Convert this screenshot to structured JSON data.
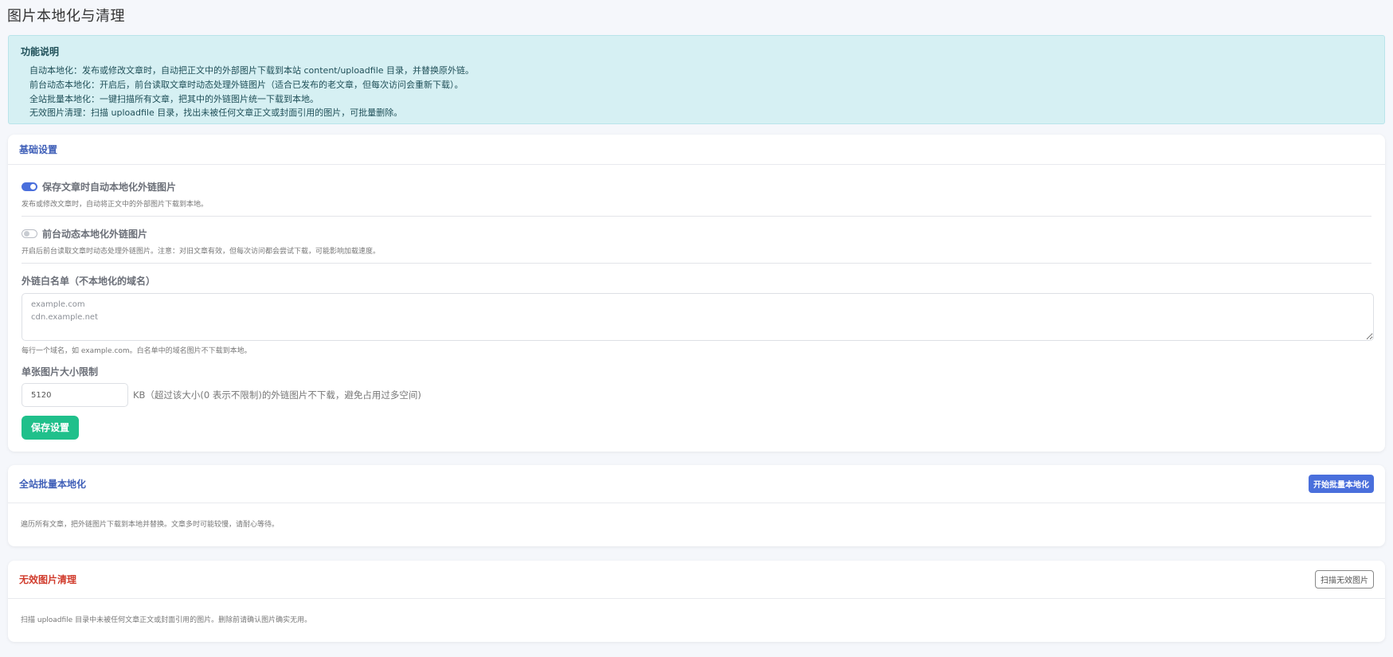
{
  "page": {
    "title": "图片本地化与清理"
  },
  "info": {
    "title": "功能说明",
    "lines": [
      "自动本地化：发布或修改文章时，自动把正文中的外部图片下载到本站 content/uploadfile 目录，并替换原外链。",
      "前台动态本地化：开启后，前台读取文章时动态处理外链图片（适合已发布的老文章，但每次访问会重新下载）。",
      "全站批量本地化：一键扫描所有文章，把其中的外链图片统一下载到本地。",
      "无效图片清理：扫描 uploadfile 目录，找出未被任何文章正文或封面引用的图片，可批量删除。"
    ]
  },
  "settings": {
    "title": "基础设置",
    "auto_localize": {
      "label": "保存文章时自动本地化外链图片",
      "help": "发布或修改文章时，自动将正文中的外部图片下载到本地。",
      "enabled": true
    },
    "dynamic_localize": {
      "label": "前台动态本地化外链图片",
      "help": "开启后前台读取文章时动态处理外链图片。注意：对旧文章有效，但每次访问都会尝试下载，可能影响加载速度。",
      "enabled": false
    },
    "whitelist": {
      "label": "外链白名单（不本地化的域名）",
      "placeholder": "example.com\ncdn.example.net",
      "value": "",
      "help": "每行一个域名，如 example.com。白名单中的域名图片不下载到本地。"
    },
    "size_limit": {
      "label": "单张图片大小限制",
      "value": "5120",
      "hint": "KB（超过该大小(0 表示不限制)的外链图片不下载，避免占用过多空间)"
    },
    "save_label": "保存设置"
  },
  "batch": {
    "title": "全站批量本地化",
    "button": "开始批量本地化",
    "desc": "遍历所有文章，把外链图片下载到本地并替换。文章多时可能较慢，请耐心等待。"
  },
  "cleanup": {
    "title": "无效图片清理",
    "button": "扫描无效图片",
    "desc": "扫描 uploadfile 目录中未被任何文章正文或封面引用的图片。删除前请确认图片确实无用。"
  },
  "colors": {
    "accent": "#4a6fdc",
    "success": "#20c08b",
    "danger": "#d03a2b",
    "info_bg": "#d6f0f3"
  }
}
